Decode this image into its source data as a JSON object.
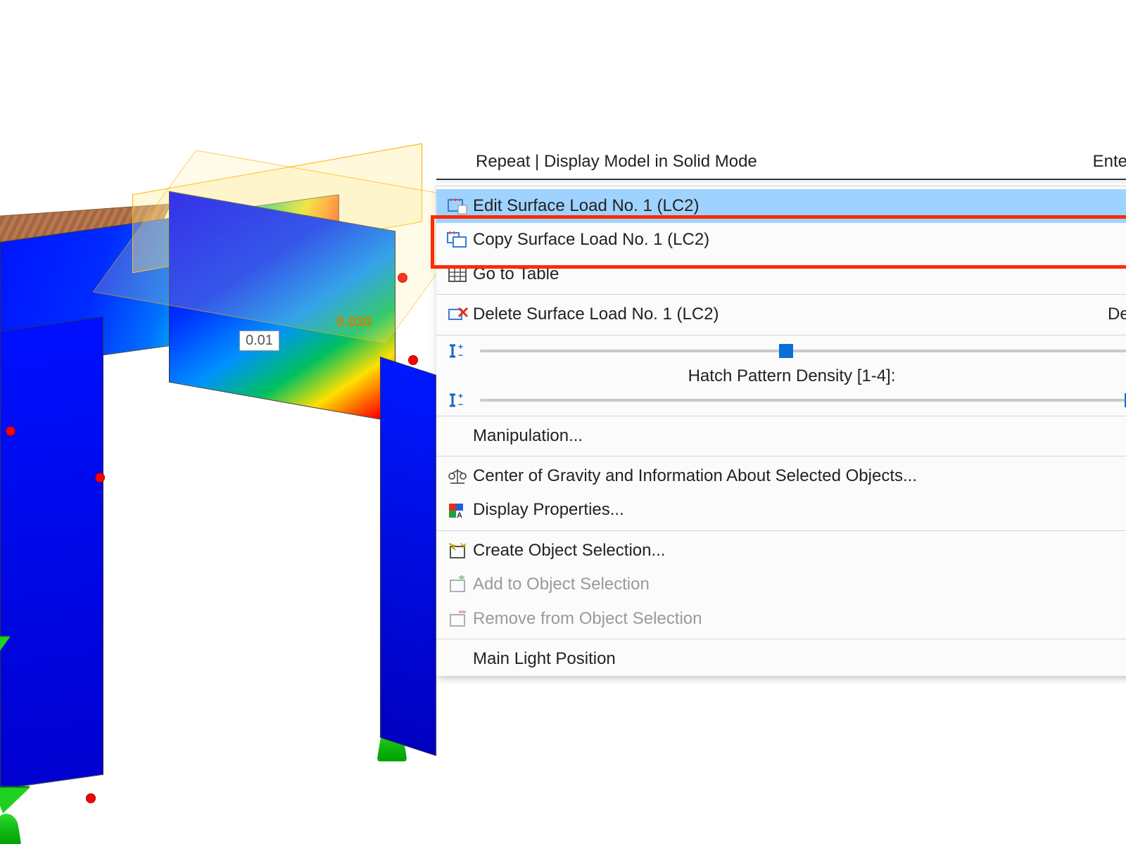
{
  "model": {
    "dim_label_a": "0.01",
    "dim_label_b": "0.030"
  },
  "menu": {
    "repeat_label": "Repeat | Display Model in Solid Mode",
    "repeat_accel": "Enter",
    "edit_label": "Edit Surface Load No. 1 (LC2)",
    "copy_label": "Copy Surface Load No. 1 (LC2)",
    "goto_label": "Go to Table",
    "delete_label": "Delete Surface Load No. 1 (LC2)",
    "delete_accel": "Del",
    "hatch_caption": "Hatch Pattern Density [1-4]:",
    "manipulation_label": "Manipulation...",
    "cog_label": "Center of Gravity and Information About Selected Objects...",
    "display_props_label": "Display Properties...",
    "create_sel_label": "Create Object Selection...",
    "add_sel_label": "Add to Object Selection",
    "remove_sel_label": "Remove from Object Selection",
    "light_label": "Main Light Position"
  },
  "sliders": {
    "load_size_percent": 47,
    "hatch_density_percent": 100
  }
}
